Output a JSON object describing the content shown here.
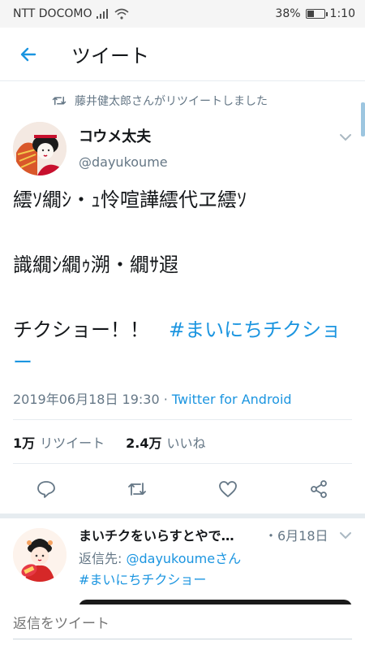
{
  "status_bar": {
    "carrier": "NTT DOCOMO",
    "battery": "38%",
    "battery_level": 0.38,
    "time": "1:10"
  },
  "app_bar": {
    "title": "ツイート"
  },
  "retweet_note": "藤井健太郎さんがリツイートしました",
  "tweet": {
    "author_name": "コウメ太夫",
    "author_handle": "@dayukoume",
    "lines": [
      "繧ｿ繝ｼ・ｭ怜喧譁繧代ヱ繧ｿ",
      "",
      "識繝ｼ繝ｩ溯・繝ｻ遐",
      "",
      "チクショー！！　"
    ],
    "hashtag": "#まいにちチクショー",
    "timestamp": "2019年06月18日 19:30",
    "via": "Twitter for Android",
    "retweet_count": "1万",
    "retweet_label": "リツイート",
    "like_count": "2.4万",
    "like_label": "いいね"
  },
  "reply": {
    "author_name": "まいチクをいらすとやで…",
    "date": "・6月18日",
    "reply_to_label": "返信先: ",
    "reply_to_mention": "@dayukoumeさん",
    "hashtag": "#まいにちチクショー"
  },
  "composer": {
    "placeholder": "返信をツイート"
  },
  "colors": {
    "accent": "#1b95e0",
    "text": "#14171a",
    "secondary": "#657786",
    "divider": "#e6ecf0"
  },
  "icons": [
    "back-arrow-icon",
    "retweet-icon",
    "chevron-down-icon",
    "reply-icon",
    "share-icon",
    "like-icon",
    "signal-icon",
    "wifi-icon",
    "battery-icon"
  ]
}
